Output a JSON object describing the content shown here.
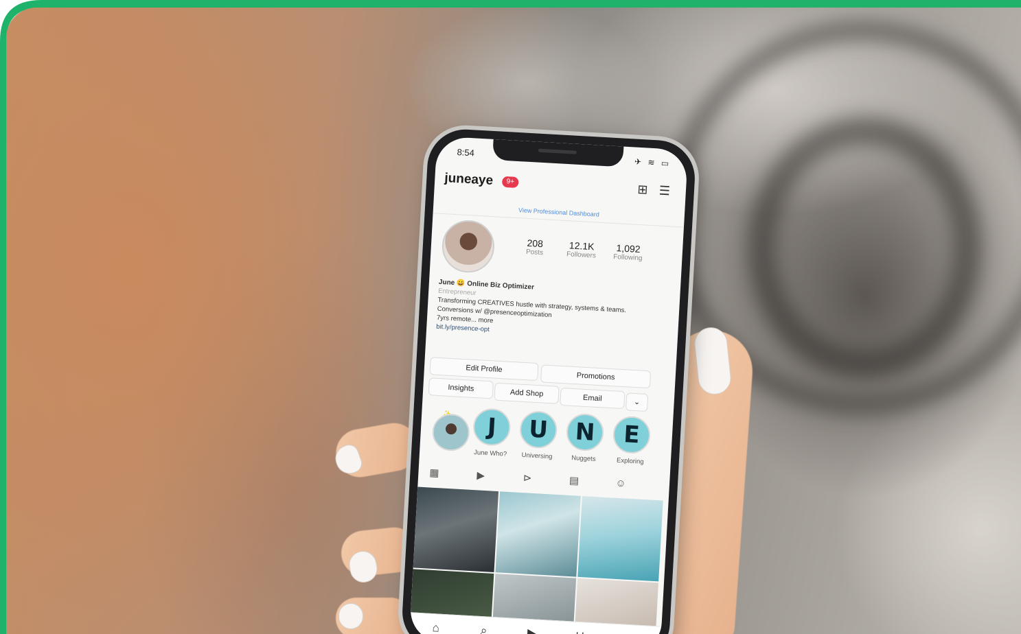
{
  "accent_color": "#1fb26b",
  "status_bar": {
    "time": "8:54",
    "icons": "✈ ≋ ▭"
  },
  "profile": {
    "username": "juneaye",
    "notifications_badge": "9+",
    "dashboard_link": "View Professional Dashboard",
    "stats": [
      {
        "value": "208",
        "label": "Posts"
      },
      {
        "value": "12.1K",
        "label": "Followers"
      },
      {
        "value": "1,092",
        "label": "Following"
      }
    ],
    "bio": {
      "name_line": "June 😀 Online Biz Optimizer",
      "category": "Entrepreneur",
      "line1": "Transforming CREATIVES hustle with strategy, systems & teams.",
      "line2": "Conversions w/ @presenceoptimization",
      "line3": "7yrs remote... more",
      "link": "bit.ly/presence-opt"
    }
  },
  "buttons": {
    "edit_profile": "Edit Profile",
    "promotions": "Promotions",
    "insights": "Insights",
    "add_shop": "Add Shop",
    "email": "Email",
    "more": "⌄"
  },
  "highlights": [
    {
      "letter": "",
      "label": "✨"
    },
    {
      "letter": "J",
      "label": "June Who?"
    },
    {
      "letter": "U",
      "label": "Universing"
    },
    {
      "letter": "N",
      "label": "Nuggets"
    },
    {
      "letter": "E",
      "label": "Exploring"
    }
  ],
  "icons": {
    "new_post": "⊞",
    "menu": "☰",
    "grid_tab": "▦",
    "reels_tab": "▶",
    "video_tab": "⊳",
    "guides_tab": "▤",
    "tagged_tab": "☺",
    "home": "⌂",
    "search": "⌕",
    "reels": "▶",
    "shop": "⊔",
    "profile": "●"
  }
}
